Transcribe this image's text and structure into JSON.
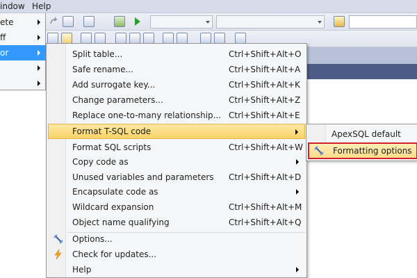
{
  "menubar": {
    "window": "indow",
    "help": "Help"
  },
  "left_menu": {
    "items": [
      {
        "label": "ete",
        "has_submenu": true
      },
      {
        "label": "ff",
        "has_submenu": true
      },
      {
        "label": "or",
        "has_submenu": true,
        "active": true
      },
      {
        "label": "",
        "has_submenu": true
      },
      {
        "label": "",
        "has_submenu": true
      }
    ]
  },
  "submenu": {
    "items": [
      {
        "label": "Split table...",
        "shortcut": "Ctrl+Shift+Alt+O"
      },
      {
        "label": "Safe rename...",
        "shortcut": "Ctrl+Shift+Alt+A"
      },
      {
        "label": "Add surrogate key...",
        "shortcut": "Ctrl+Shift+Alt+K"
      },
      {
        "label": "Change parameters...",
        "shortcut": "Ctrl+Shift+Alt+Z"
      },
      {
        "label": "Replace one-to-many relationship...",
        "shortcut": "Ctrl+Shift+Alt+E"
      },
      {
        "label": "Format T-SQL code",
        "shortcut": "",
        "has_submenu": true,
        "active": true
      },
      {
        "label": "Format SQL scripts",
        "shortcut": "Ctrl+Shift+Alt+W"
      },
      {
        "label": "Copy code as",
        "shortcut": "",
        "has_submenu": true
      },
      {
        "label": "Unused variables and parameters",
        "shortcut": "Ctrl+Shift+Alt+D"
      },
      {
        "label": "Encapsulate code as",
        "shortcut": "",
        "has_submenu": true
      },
      {
        "label": "Wildcard expansion",
        "shortcut": "Ctrl+Shift+Alt+M"
      },
      {
        "label": "Object name qualifying",
        "shortcut": "Ctrl+Shift+Alt+Q"
      },
      {
        "label": "Options...",
        "shortcut": "",
        "icon": "options-wrench-icon"
      },
      {
        "label": "Check for updates...",
        "shortcut": "",
        "icon": "lightning-icon"
      },
      {
        "label": "Help",
        "shortcut": "",
        "has_submenu": true
      }
    ]
  },
  "nested_menu": {
    "items": [
      {
        "label": "ApexSQL default"
      },
      {
        "label": "Formatting options",
        "icon": "options-wrench-icon",
        "highlighted": true
      }
    ]
  },
  "colors": {
    "menu_bg": "#f5f6f7",
    "active_item": "#f8d366",
    "highlight_border": "#d0202a",
    "left_active": "#3399ff",
    "dark_band": "#4b5c86"
  }
}
